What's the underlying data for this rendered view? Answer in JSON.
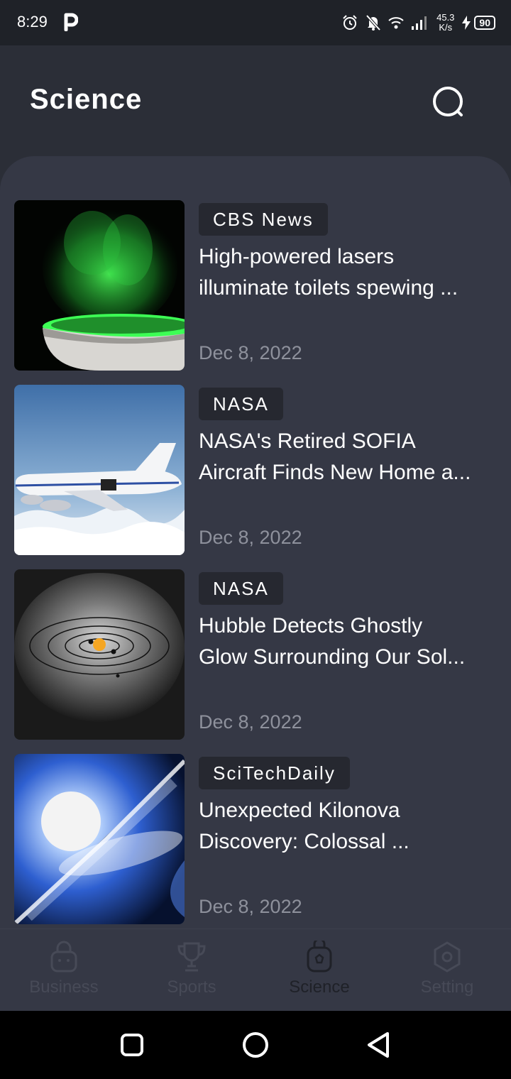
{
  "status_bar": {
    "time": "8:29",
    "app_badge": "P",
    "net_speed_value": "45.3",
    "net_speed_unit": "K/s",
    "battery": "90"
  },
  "header": {
    "title": "Science"
  },
  "articles": [
    {
      "source": "CBS News",
      "headline_line1": "High-powered lasers",
      "headline_line2": "illuminate toilets spewing ...",
      "date": "Dec 8, 2022"
    },
    {
      "source": "NASA",
      "headline_line1": "NASA's Retired SOFIA",
      "headline_line2": "Aircraft Finds New Home a...",
      "date": "Dec 8, 2022"
    },
    {
      "source": "NASA",
      "headline_line1": "Hubble Detects Ghostly",
      "headline_line2": "Glow Surrounding Our Sol...",
      "date": "Dec 8, 2022"
    },
    {
      "source": "SciTechDaily",
      "headline_line1": "Unexpected Kilonova",
      "headline_line2": "Discovery: Colossal ...",
      "date": "Dec 8, 2022"
    }
  ],
  "bottom_nav": [
    {
      "label": "Business",
      "icon": "shopping-bag-icon",
      "active": false
    },
    {
      "label": "Sports",
      "icon": "trophy-icon",
      "active": false
    },
    {
      "label": "Science",
      "icon": "flask-icon",
      "active": true
    },
    {
      "label": "Setting",
      "icon": "gear-hexagon-icon",
      "active": false
    }
  ],
  "colors": {
    "background": "#2b2e37",
    "panel": "#353845",
    "chip": "#262830",
    "date_text": "#8e919c"
  }
}
